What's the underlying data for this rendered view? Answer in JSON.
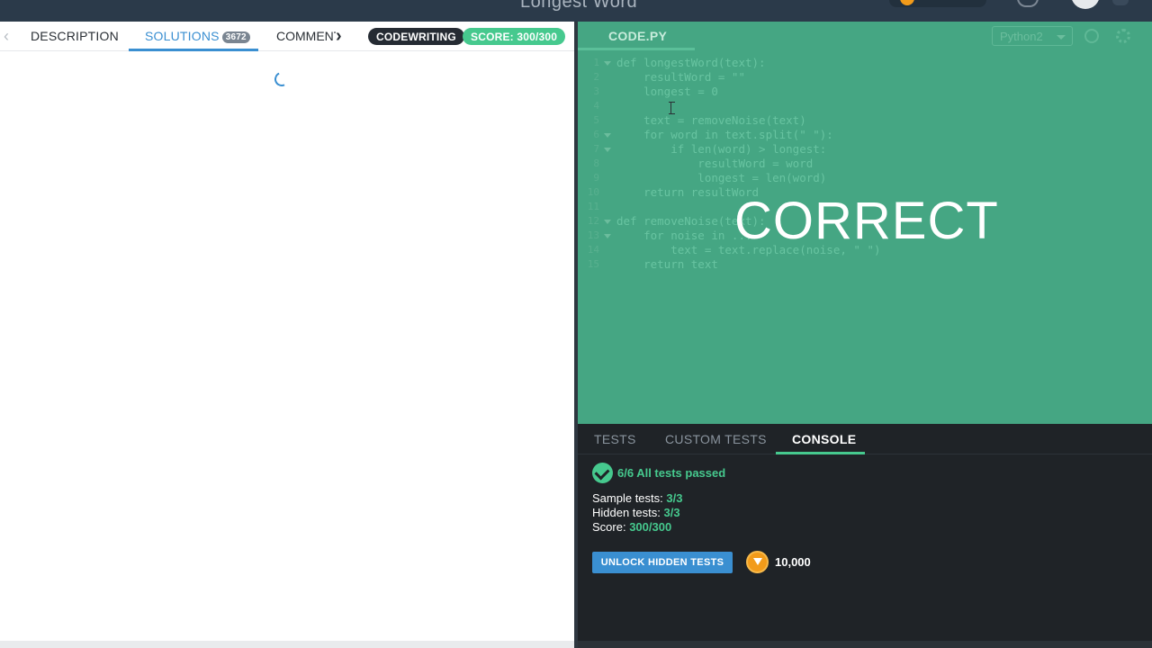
{
  "topbar": {
    "title": "Longest Word"
  },
  "left_panel": {
    "tabs": {
      "description": "DESCRIPTION",
      "solutions": "SOLUTIONS",
      "solutions_count": "3672",
      "comments": "COMMENTS"
    },
    "badges": {
      "mode": "CODEWRITING",
      "score": "SCORE: 300/300"
    }
  },
  "editor": {
    "tab": "CODE.PY",
    "language": "Python2",
    "result_overlay": "CORRECT",
    "code_lines": [
      {
        "n": "1",
        "text": "def longestWord(text):"
      },
      {
        "n": "2",
        "text": "    resultWord = \"\""
      },
      {
        "n": "3",
        "text": "    longest = 0"
      },
      {
        "n": "4",
        "text": ""
      },
      {
        "n": "5",
        "text": "    text = removeNoise(text)"
      },
      {
        "n": "6",
        "text": "    for word in text.split(\" \"):"
      },
      {
        "n": "7",
        "text": "        if len(word) > longest:"
      },
      {
        "n": "8",
        "text": "            resultWord = word"
      },
      {
        "n": "9",
        "text": "            longest = len(word)"
      },
      {
        "n": "10",
        "text": "    return resultWord"
      },
      {
        "n": "11",
        "text": ""
      },
      {
        "n": "12",
        "text": "def removeNoise(text):"
      },
      {
        "n": "13",
        "text": "    for noise in ..."
      },
      {
        "n": "14",
        "text": "        text = text.replace(noise, \" \")"
      },
      {
        "n": "15",
        "text": "    return text"
      }
    ]
  },
  "console": {
    "tabs": {
      "tests": "TESTS",
      "custom_tests": "CUSTOM TESTS",
      "console": "CONSOLE"
    },
    "summary": "6/6 All tests passed",
    "sample_label": "Sample tests:",
    "sample_value": "3/3",
    "hidden_label": "Hidden tests:",
    "hidden_value": "3/3",
    "score_label": "Score:",
    "score_value": "300/300",
    "unlock_button": "UNLOCK HIDDEN TESTS",
    "coin_amount": "10,000"
  },
  "colors": {
    "accent_blue": "#3a8fd1",
    "success_green": "#46c98e",
    "editor_bg": "#45a683",
    "console_bg": "#1f2327"
  }
}
